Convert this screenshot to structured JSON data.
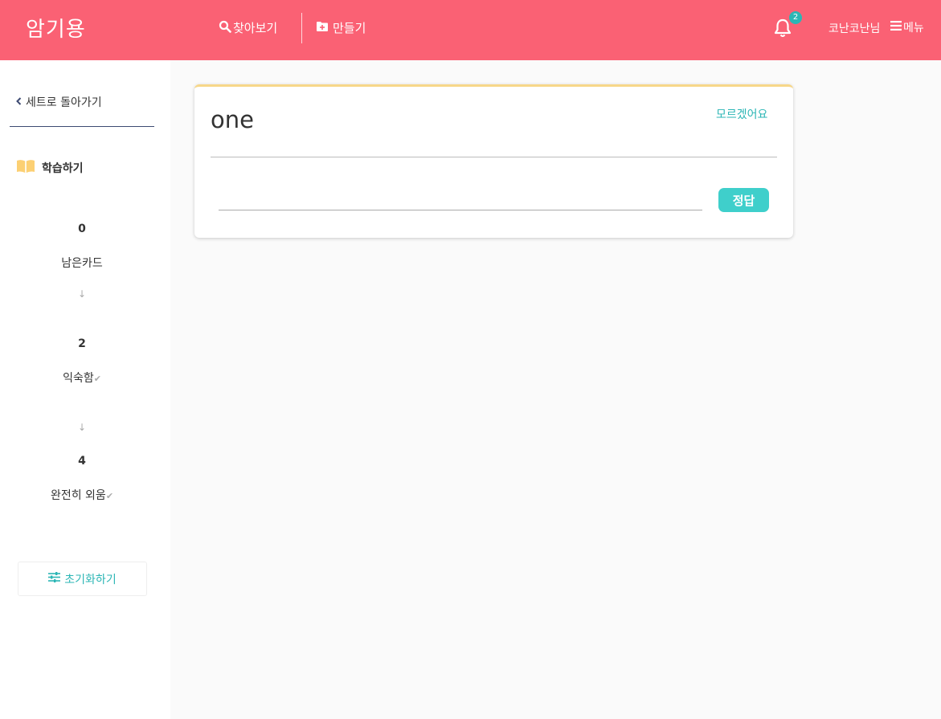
{
  "header": {
    "logo": "암기용",
    "nav_browse": "찾아보기",
    "nav_create": "만들기",
    "notification_count": "2",
    "user_name": "코난코난님",
    "menu_label": "메뉴",
    "bg_color": "#fa6174"
  },
  "sidebar": {
    "back_label": "세트로 돌아가기",
    "study_label": "학습하기",
    "stats": [
      {
        "count": "0",
        "label": "남은카드"
      },
      {
        "count": "2",
        "label": "익숙함"
      },
      {
        "count": "4",
        "label": "완전히 외움"
      }
    ],
    "reset_label": "초기화하기"
  },
  "card": {
    "word": "one",
    "dont_know_label": "모르겠어요",
    "answer_value": "",
    "answer_button": "정답",
    "accent_color": "#3fcfcb"
  }
}
